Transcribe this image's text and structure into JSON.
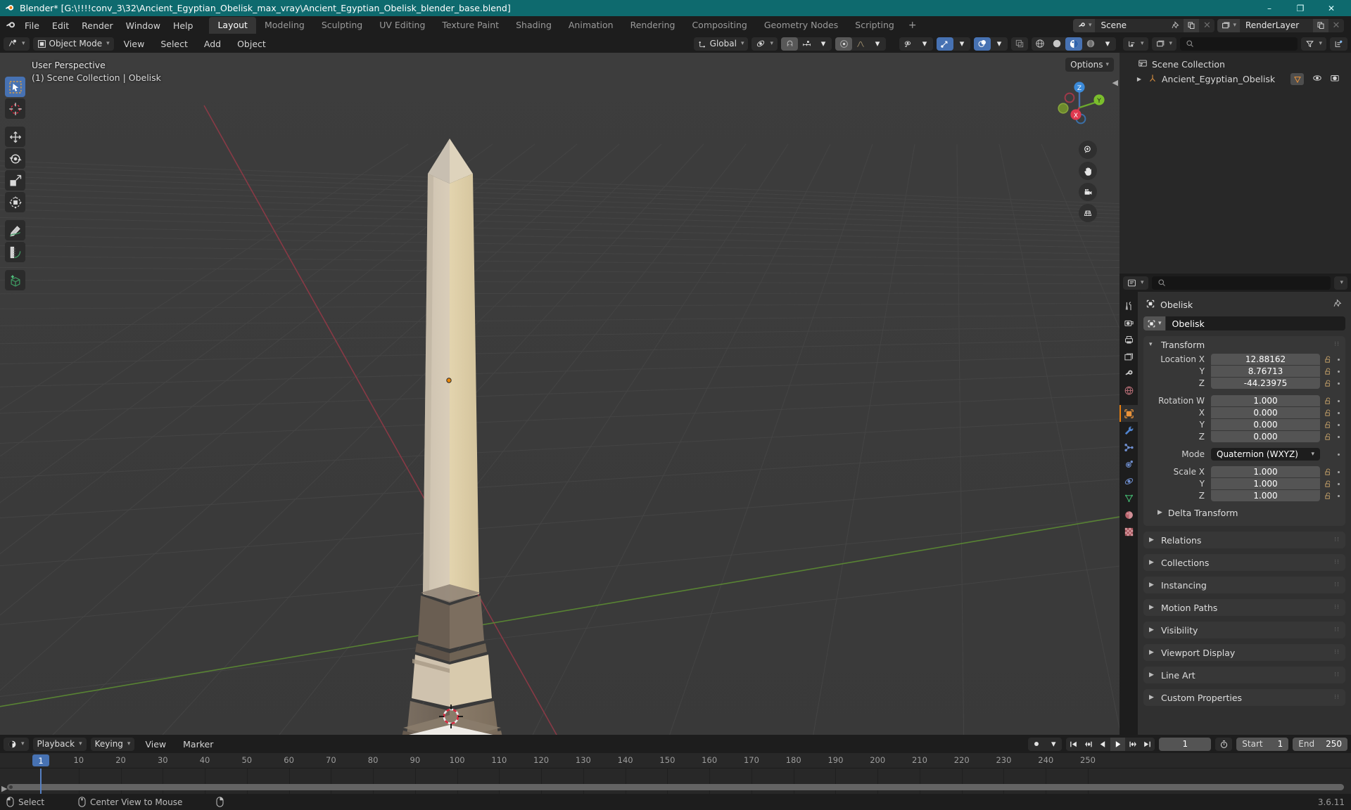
{
  "window": {
    "title": "Blender* [G:\\!!!!conv_3\\32\\Ancient_Egyptian_Obelisk_max_vray\\Ancient_Egyptian_Obelisk_blender_base.blend]",
    "minimize": "–",
    "maximize": "❐",
    "close": "✕"
  },
  "topbar": {
    "menus": [
      "File",
      "Edit",
      "Render",
      "Window",
      "Help"
    ],
    "workspaces": [
      {
        "label": "Layout",
        "active": true
      },
      {
        "label": "Modeling",
        "active": false
      },
      {
        "label": "Sculpting",
        "active": false
      },
      {
        "label": "UV Editing",
        "active": false
      },
      {
        "label": "Texture Paint",
        "active": false
      },
      {
        "label": "Shading",
        "active": false
      },
      {
        "label": "Animation",
        "active": false
      },
      {
        "label": "Rendering",
        "active": false
      },
      {
        "label": "Compositing",
        "active": false
      },
      {
        "label": "Geometry Nodes",
        "active": false
      },
      {
        "label": "Scripting",
        "active": false
      }
    ],
    "add_workspace": "+",
    "scene_name": "Scene",
    "view_layer_name": "RenderLayer"
  },
  "viewport_header": {
    "mode": "Object Mode",
    "menus": [
      "View",
      "Select",
      "Add",
      "Object"
    ],
    "transform_orientation": "Global",
    "options_label": "Options"
  },
  "viewport": {
    "perspective": "User Perspective",
    "scene_info": "(1) Scene Collection | Obelisk",
    "gizmo_axes": [
      "X",
      "Y",
      "Z"
    ],
    "grid_color": "#3b3b3b",
    "x_axis_color": "#a33b4a",
    "y_axis_color": "#5c8b34",
    "object_colors": {
      "shaft_light": "#ded1bb",
      "shaft_mid": "#e0cfa9",
      "shaft_dark": "#b8a88e",
      "base_dark": "#6f6358",
      "base_white": "#e9e6e0"
    }
  },
  "toolbar": {
    "tools": [
      {
        "name": "tweak-select-box",
        "active": true
      },
      {
        "name": "cursor",
        "active": false
      },
      {
        "name": "move",
        "active": false
      },
      {
        "name": "rotate",
        "active": false
      },
      {
        "name": "scale",
        "active": false
      },
      {
        "name": "transform",
        "active": false
      },
      {
        "name": "annotate",
        "active": false
      },
      {
        "name": "measure",
        "active": false
      },
      {
        "name": "add-cube",
        "active": false
      }
    ]
  },
  "outliner": {
    "search_placeholder": "",
    "rows": [
      {
        "indent": 0,
        "label": "Scene Collection",
        "icon": "collection-icon",
        "has_tri": false,
        "badge": false
      },
      {
        "indent": 1,
        "label": "Ancient_Egyptian_Obelisk",
        "icon": "armature-icon",
        "has_tri": true,
        "badge": true
      }
    ]
  },
  "properties": {
    "search_placeholder": "",
    "breadcrumb_object": "Obelisk",
    "object_name_field": "Obelisk",
    "tabs": [
      {
        "name": "tool",
        "active": false
      },
      {
        "name": "render",
        "active": false
      },
      {
        "name": "output",
        "active": false
      },
      {
        "name": "view-layer",
        "active": false
      },
      {
        "name": "scene",
        "active": false
      },
      {
        "name": "world",
        "active": false
      },
      {
        "name": "object",
        "active": true
      },
      {
        "name": "modifiers",
        "active": false
      },
      {
        "name": "particles",
        "active": false
      },
      {
        "name": "physics",
        "active": false
      },
      {
        "name": "constraints",
        "active": false
      },
      {
        "name": "data",
        "active": false
      },
      {
        "name": "material",
        "active": false
      },
      {
        "name": "texture",
        "active": false
      }
    ],
    "transform": {
      "title": "Transform",
      "location": {
        "label_x": "Location X",
        "label_y": "Y",
        "label_z": "Z",
        "x": "12.88162",
        "y": "8.76713",
        "z": "-44.23975"
      },
      "rotation": {
        "label_w": "Rotation W",
        "label_x": "X",
        "label_y": "Y",
        "label_z": "Z",
        "w": "1.000",
        "x": "0.000",
        "y": "0.000",
        "z": "0.000"
      },
      "mode": {
        "label": "Mode",
        "value": "Quaternion (WXYZ)"
      },
      "scale": {
        "label_x": "Scale X",
        "label_y": "Y",
        "label_z": "Z",
        "x": "1.000",
        "y": "1.000",
        "z": "1.000"
      },
      "delta_transform": "Delta Transform"
    },
    "panels": [
      "Relations",
      "Collections",
      "Instancing",
      "Motion Paths",
      "Visibility",
      "Viewport Display",
      "Line Art",
      "Custom Properties"
    ]
  },
  "timeline": {
    "menus": [
      "Playback",
      "Keying",
      "View",
      "Marker"
    ],
    "current_frame": "1",
    "start_label": "Start",
    "start_value": "1",
    "end_label": "End",
    "end_value": "250",
    "ticks": [
      "10",
      "20",
      "30",
      "40",
      "50",
      "60",
      "70",
      "80",
      "90",
      "100",
      "110",
      "120",
      "130",
      "140",
      "150",
      "160",
      "170",
      "180",
      "190",
      "200",
      "210",
      "220",
      "230",
      "240",
      "250"
    ],
    "playhead_frame": "1"
  },
  "statusbar": {
    "select_label": "Select",
    "center_view_label": "Center View to Mouse",
    "version": "3.6.11"
  }
}
